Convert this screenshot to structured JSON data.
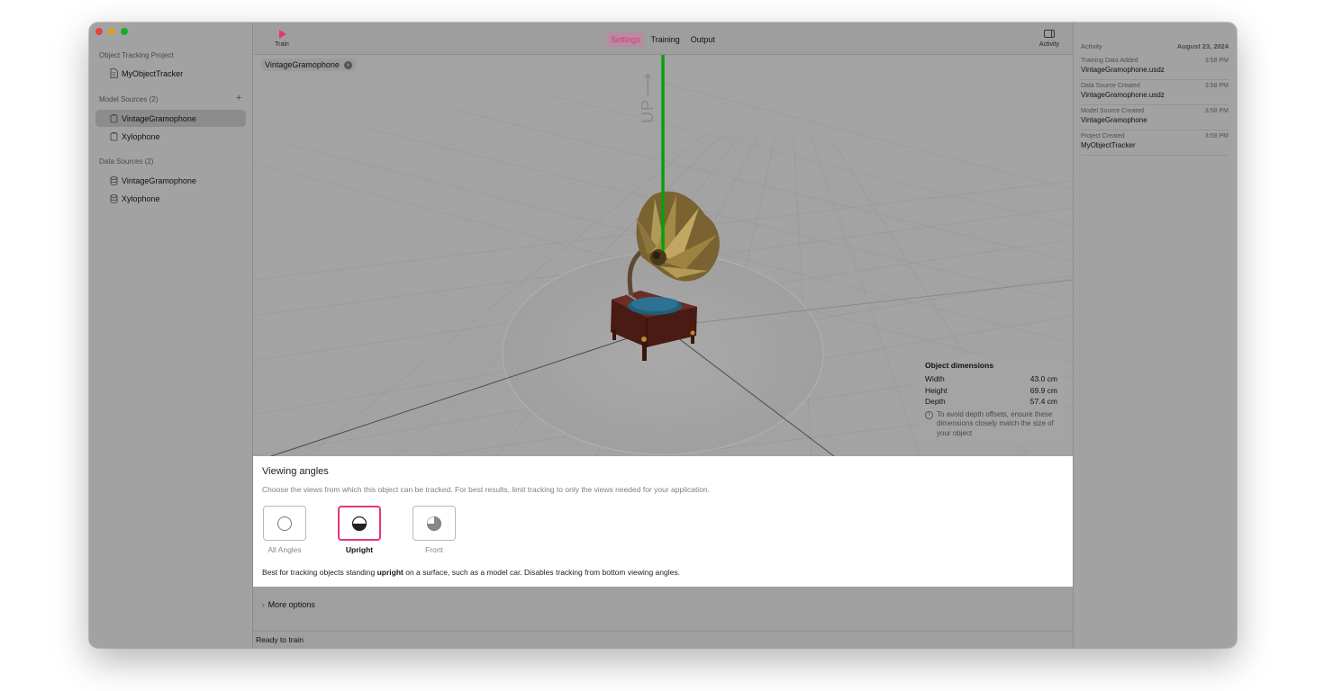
{
  "sidebar": {
    "project_section": "Object Tracking Project",
    "project_name": "MyObjectTracker",
    "model_sources_title": "Model Sources (2)",
    "add_symbol": "+",
    "model_sources": [
      {
        "label": "VintageGramophone",
        "selected": true
      },
      {
        "label": "Xylophone",
        "selected": false
      }
    ],
    "data_sources_title": "Data Sources (2)",
    "data_sources": [
      {
        "label": "VintageGramophone"
      },
      {
        "label": "Xylophone"
      }
    ]
  },
  "toolbar": {
    "train_label": "Train",
    "tabs": [
      {
        "label": "Settings",
        "active": true
      },
      {
        "label": "Training",
        "active": false
      },
      {
        "label": "Output",
        "active": false
      }
    ],
    "activity_label": "Activity",
    "accent_color": "#e6357c"
  },
  "viewport": {
    "model_chip": "VintageGramophone",
    "up_label": "UP",
    "dimensions": {
      "title": "Object dimensions",
      "rows": [
        {
          "label": "Width",
          "value": "43.0 cm"
        },
        {
          "label": "Height",
          "value": "69.9 cm"
        },
        {
          "label": "Depth",
          "value": "57.4 cm"
        }
      ],
      "note": "To avoid depth offsets, ensure these dimensions closely match the size of your object"
    }
  },
  "viewing_angles": {
    "title": "Viewing angles",
    "subtitle": "Choose the views from which this object can be tracked. For best results, limit tracking to only the views needed for your application.",
    "options": [
      {
        "label": "All Angles",
        "icon": "circle-outline-icon",
        "selected": false
      },
      {
        "label": "Upright",
        "icon": "half-circle-icon",
        "selected": true
      },
      {
        "label": "Front",
        "icon": "quarter-circle-icon",
        "selected": false
      }
    ],
    "description_before": "Best for tracking objects standing ",
    "description_bold": "upright",
    "description_after": " on a surface, such as a model car. Disables tracking from bottom viewing angles."
  },
  "bottom": {
    "more_options": "More options",
    "status": "Ready to train"
  },
  "activity": {
    "title": "Activity",
    "date": "August 23, 2024",
    "items": [
      {
        "event": "Training Data Added",
        "time": "3:58 PM",
        "name": "VintageGramophone.usdz"
      },
      {
        "event": "Data Source Created",
        "time": "3:58 PM",
        "name": "VintageGramophone.usdz"
      },
      {
        "event": "Model Source Created",
        "time": "3:58 PM",
        "name": "VintageGramophone"
      },
      {
        "event": "Project Created",
        "time": "3:58 PM",
        "name": "MyObjectTracker"
      }
    ]
  }
}
